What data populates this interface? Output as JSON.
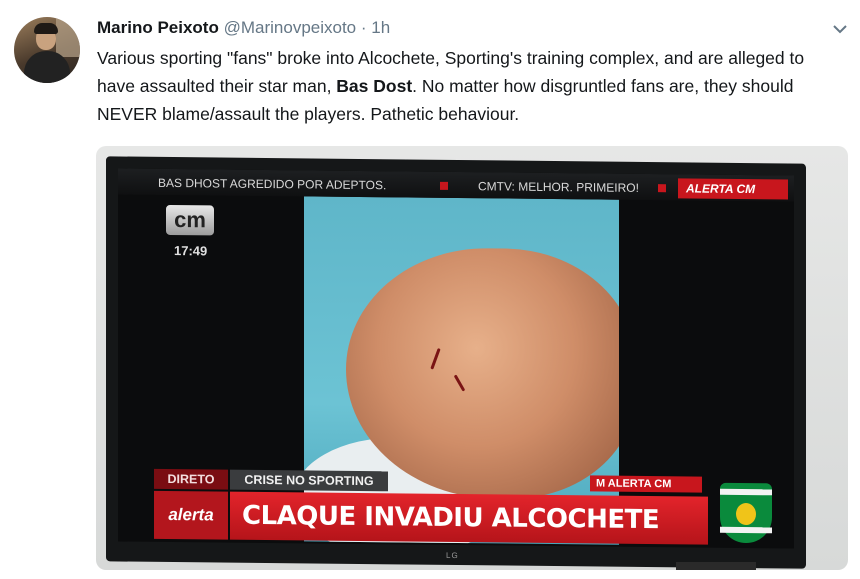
{
  "tweet": {
    "author_name": "Marino Peixoto",
    "handle": "@Marinovpeixoto",
    "separator": "·",
    "time": "1h",
    "text_before": "Various sporting \"fans\" broke into Alcochete, Sporting's training complex, and are alleged to have assaulted their star man, ",
    "text_bold": "Bas Dost",
    "text_after": ". No matter how disgruntled fans are, they should NEVER blame/assault the players. Pathetic behaviour.",
    "menu_icon": "chevron-down-icon"
  },
  "tv": {
    "ticker_left": "BAS DHOST AGREDIDO POR ADEPTOS.",
    "ticker_mid": "CMTV: MELHOR. PRIMEIRO!",
    "ticker_alert": "ALERTA CM",
    "channel_logo": "cm",
    "clock": "17:49",
    "label_direto": "DIRETO",
    "label_crise": "CRISE NO SPORTING",
    "label_alerta_small": "M  ALERTA CM",
    "alerta_logo": "alerta",
    "headline": "CLAQUE INVADIU ALCOCHETE",
    "tv_brand": "LG",
    "accent_red": "#c8161d",
    "club_green": "#0a8a3c"
  }
}
